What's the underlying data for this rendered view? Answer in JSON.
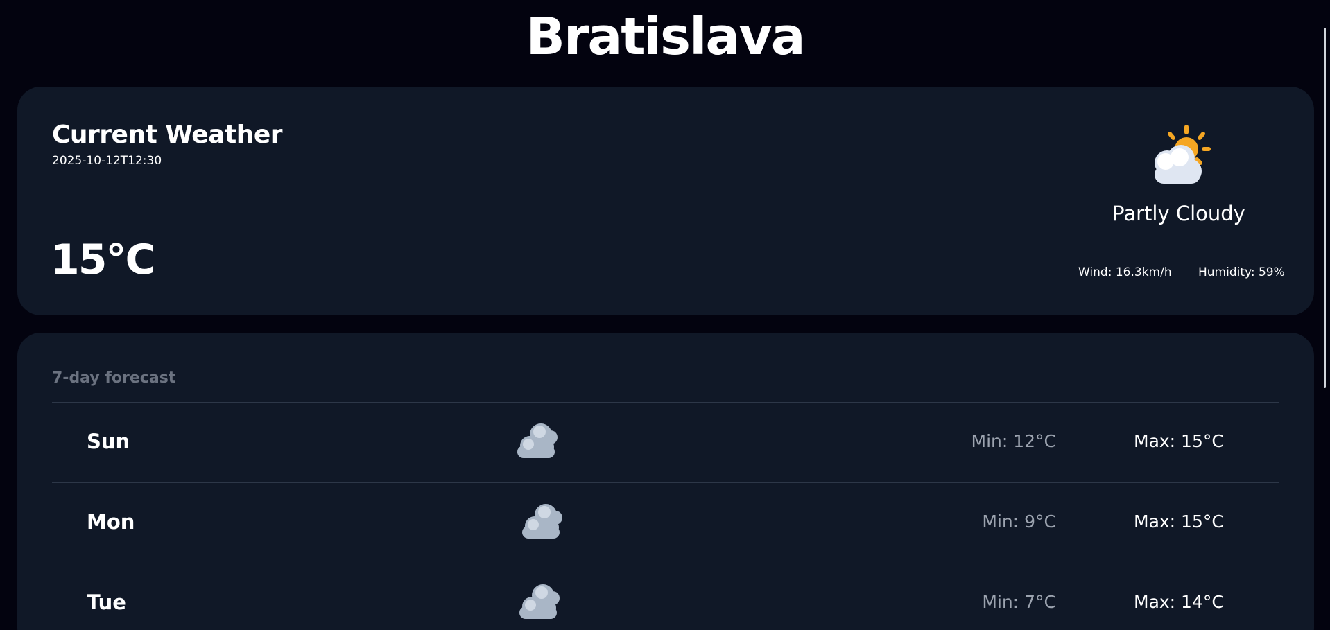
{
  "city": "Bratislava",
  "current": {
    "heading": "Current Weather",
    "time": "2025-10-12T12:30",
    "temperature": "15°C",
    "icon": "partly-cloudy-icon",
    "description": "Partly Cloudy",
    "wind": "Wind: 16.3km/h",
    "humidity": "Humidity: 59%"
  },
  "forecast": {
    "heading": "7-day forecast",
    "days": [
      {
        "day": "Sun",
        "icon": "clouds-icon",
        "min": "Min: 12°C",
        "max": "Max: 15°C"
      },
      {
        "day": "Mon",
        "icon": "clouds-icon",
        "min": "Min: 9°C",
        "max": "Max: 15°C"
      },
      {
        "day": "Tue",
        "icon": "clouds-icon",
        "min": "Min: 7°C",
        "max": "Max: 14°C"
      }
    ]
  },
  "colors": {
    "background": "#03030f",
    "card": "#101827",
    "muted_text": "#9ca3af",
    "heading_muted": "#6b7280",
    "sun": "#f5a623"
  }
}
